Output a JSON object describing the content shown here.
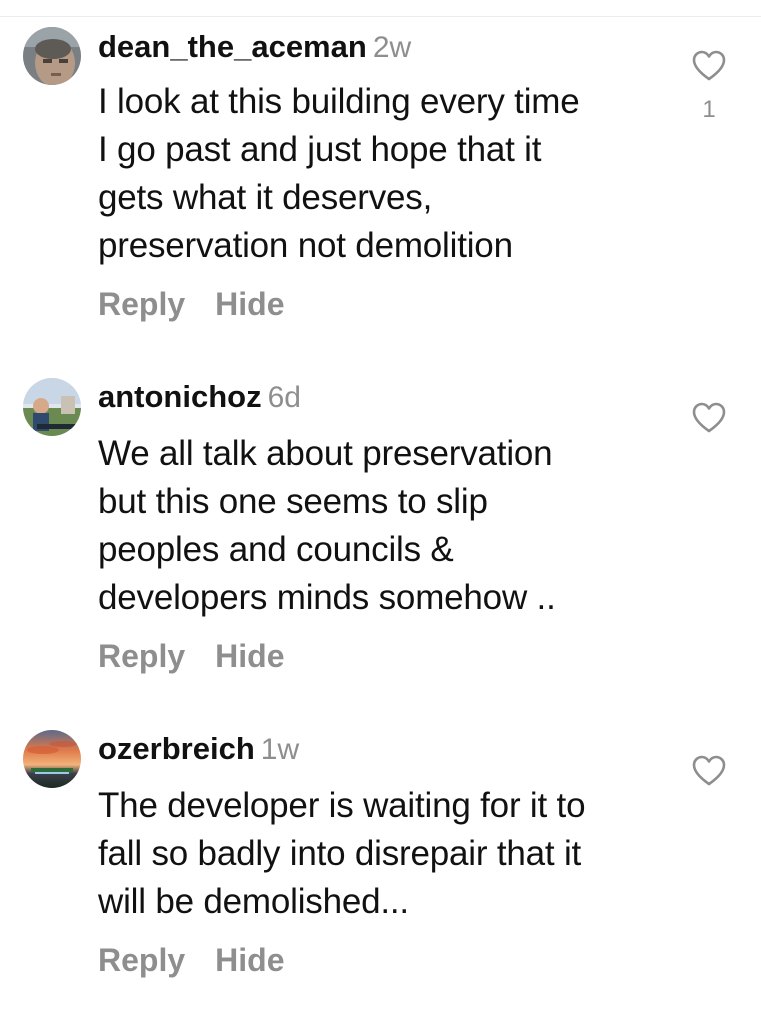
{
  "comments": [
    {
      "username": "dean_the_aceman",
      "time": "2w",
      "lines": [
        "I look at this building every time",
        "I go past and just hope that it",
        "gets what it deserves,",
        "preservation not demolition"
      ],
      "likes": "1",
      "reply_label": "Reply",
      "hide_label": "Hide"
    },
    {
      "username": "antonichoz",
      "time": "6d",
      "lines": [
        "We all talk about preservation",
        "but this one seems to slip",
        "peoples and councils &",
        "developers minds somehow .."
      ],
      "reply_label": "Reply",
      "hide_label": "Hide"
    },
    {
      "username": "ozerbreich",
      "time": "1w",
      "lines": [
        "The developer is waiting for it to",
        "fall so badly into disrepair that it",
        "will be demolished..."
      ],
      "reply_label": "Reply",
      "hide_label": "Hide"
    }
  ],
  "icons": {
    "like": "heart-outline-icon"
  },
  "colors": {
    "text": "#111111",
    "secondary": "#8e8e8e",
    "background": "#ffffff"
  }
}
